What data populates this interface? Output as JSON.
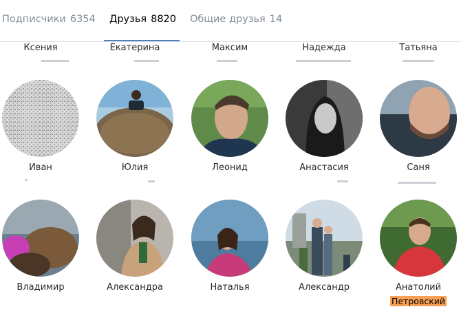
{
  "tabs": [
    {
      "label": "Подписчики",
      "count": "6354"
    },
    {
      "label": "Друзья",
      "count": "8820"
    },
    {
      "label": "Общие друзья",
      "count": "14"
    }
  ],
  "top_row_names": [
    "Ксения",
    "Екатерина",
    "Максим",
    "Надежда",
    "Татьяна"
  ],
  "row2_names": [
    "Иван",
    "Юлия",
    "Леонид",
    "Анастасия",
    "Саня"
  ],
  "row3_names": [
    "Владимир",
    "Александра",
    "Наталья",
    "Александр",
    "Анатолий"
  ],
  "highlight_text": "Петровский",
  "colors": {
    "accent": "#5181b8",
    "highlight": "#f7a156",
    "tab_inactive": "#818c99"
  }
}
